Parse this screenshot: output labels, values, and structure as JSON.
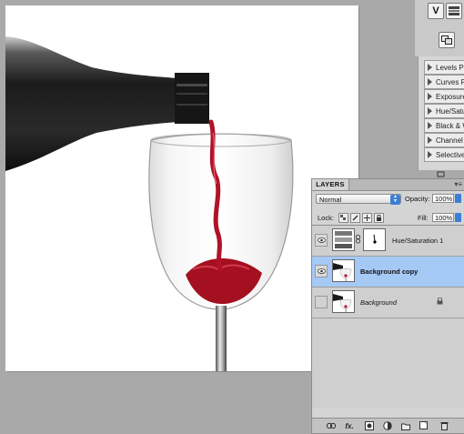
{
  "adjustments": {
    "items": [
      {
        "label": "Levels Pr"
      },
      {
        "label": "Curves Pr"
      },
      {
        "label": "Exposure"
      },
      {
        "label": "Hue/Satu"
      },
      {
        "label": "Black & W"
      },
      {
        "label": "Channel"
      },
      {
        "label": "Selective"
      }
    ]
  },
  "layers_panel": {
    "tab_label": "LAYERS",
    "menu_glyph": "▾≡",
    "blend_mode": "Normal",
    "opacity_label": "Opacity:",
    "opacity_value": "100%",
    "lock_label": "Lock:",
    "fill_label": "Fill:",
    "fill_value": "100%",
    "layers": [
      {
        "name": "Hue/Saturation 1",
        "visible": true,
        "selected": false,
        "italic": false
      },
      {
        "name": "Background copy",
        "visible": true,
        "selected": true,
        "italic": false
      },
      {
        "name": "Background",
        "visible": false,
        "selected": false,
        "italic": true,
        "locked": true
      }
    ],
    "footer_icons": [
      "link-icon",
      "fx-icon",
      "mask-icon",
      "adjustment-icon",
      "group-icon",
      "new-layer-icon",
      "trash-icon"
    ],
    "fx_label": "fx."
  },
  "colors": {
    "selection": "#a5c9f5",
    "wine": "#b01227",
    "accent_blue": "#3b7fd6"
  }
}
